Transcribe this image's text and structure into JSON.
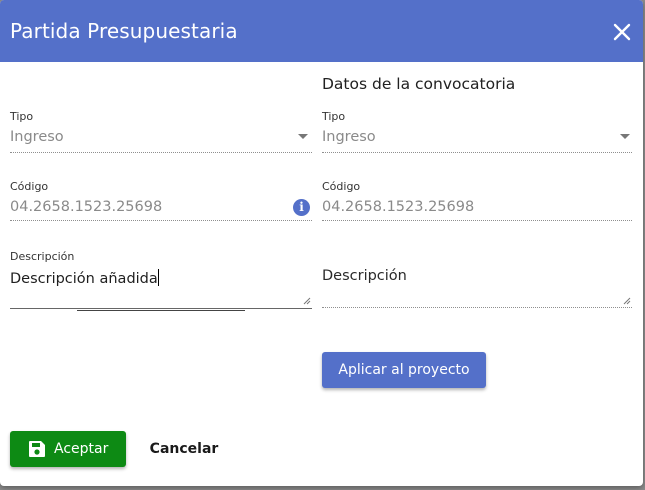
{
  "dialog": {
    "title": "Partida Presupuestaria",
    "close_icon": "close-icon",
    "header_color": "#5470c9"
  },
  "left": {
    "tipo": {
      "label": "Tipo",
      "value": "Ingreso"
    },
    "codigo": {
      "label": "Código",
      "value": "04.2658.1523.25698",
      "icon": "info-icon"
    },
    "descripcion": {
      "label": "Descripción",
      "value": "Descripción añadida"
    }
  },
  "right": {
    "section_title": "Datos de la convocatoria",
    "tipo": {
      "label": "Tipo",
      "value": "Ingreso"
    },
    "codigo": {
      "label": "Código",
      "value": "04.2658.1523.25698"
    },
    "descripcion": {
      "placeholder": "Descripción"
    },
    "apply_button": "Aplicar al proyecto"
  },
  "footer": {
    "accept_label": "Aceptar",
    "accept_icon": "save-icon",
    "accept_color": "#0d8a14",
    "cancel_label": "Cancelar"
  }
}
